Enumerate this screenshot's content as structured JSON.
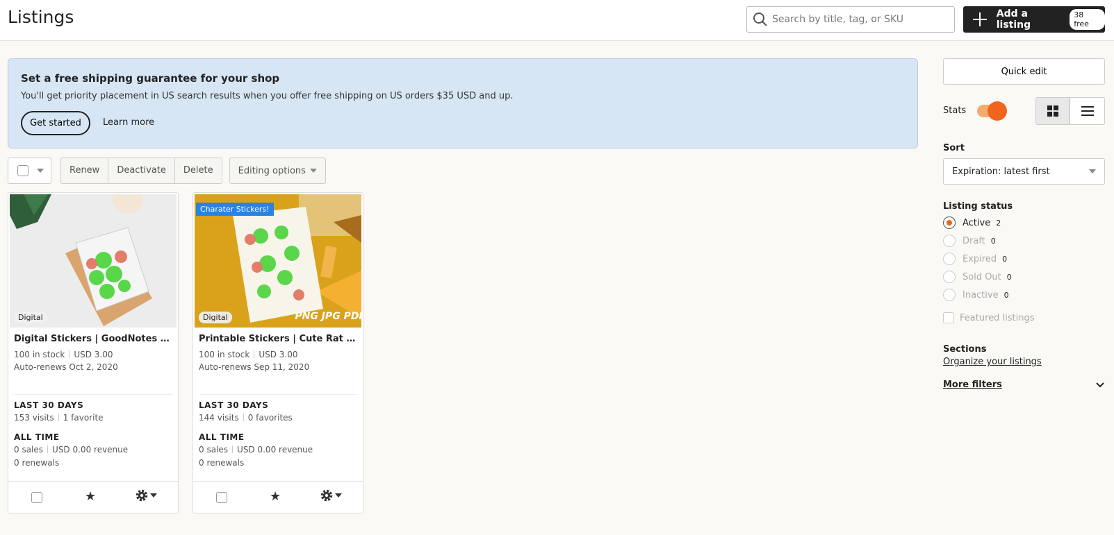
{
  "header": {
    "title": "Listings",
    "search_placeholder": "Search by title, tag, or SKU",
    "add_label": "Add a listing",
    "add_badge": "38 free"
  },
  "banner": {
    "title": "Set a free shipping guarantee for your shop",
    "text": "You'll get priority placement in US search results when you offer free shipping on US orders $35 USD and up.",
    "primary": "Get started",
    "secondary": "Learn more"
  },
  "toolbar": {
    "renew": "Renew",
    "deactivate": "Deactivate",
    "delete": "Delete",
    "editing": "Editing options"
  },
  "listings": [
    {
      "tag": "Digital",
      "title": "Digital Stickers | GoodNotes Stickers",
      "stock": "100 in stock",
      "price": "USD 3.00",
      "renews": "Auto-renews Oct 2, 2020",
      "last30_label": "LAST 30 DAYS",
      "visits": "153 visits",
      "favorites": "1 favorite",
      "alltime_label": "ALL TIME",
      "sales": "0 sales",
      "revenue": "USD 0.00 revenue",
      "renewals": "0 renewals"
    },
    {
      "tag": "Digital",
      "ribbon": "Charater Stickers!",
      "img_text": "PNG JPG PDF",
      "title": "Printable Stickers | Cute Rat Stickers",
      "stock": "100 in stock",
      "price": "USD 3.00",
      "renews": "Auto-renews Sep 11, 2020",
      "last30_label": "LAST 30 DAYS",
      "visits": "144 visits",
      "favorites": "0 favorites",
      "alltime_label": "ALL TIME",
      "sales": "0 sales",
      "revenue": "USD 0.00 revenue",
      "renewals": "0 renewals"
    }
  ],
  "sidebar": {
    "quick_edit": "Quick edit",
    "stats_label": "Stats",
    "stats_on": true,
    "sort_label": "Sort",
    "sort_value": "Expiration: latest first",
    "status_label": "Listing status",
    "statuses": [
      {
        "label": "Active",
        "count": "2"
      },
      {
        "label": "Draft",
        "count": "0"
      },
      {
        "label": "Expired",
        "count": "0"
      },
      {
        "label": "Sold Out",
        "count": "0"
      },
      {
        "label": "Inactive",
        "count": "0"
      }
    ],
    "featured": "Featured listings",
    "sections_label": "Sections",
    "organize": "Organize your listings",
    "more_filters": "More filters"
  },
  "colors": {
    "accent": "#f1641e",
    "banner_bg": "#d7e6f5",
    "primary_button": "#222222"
  }
}
